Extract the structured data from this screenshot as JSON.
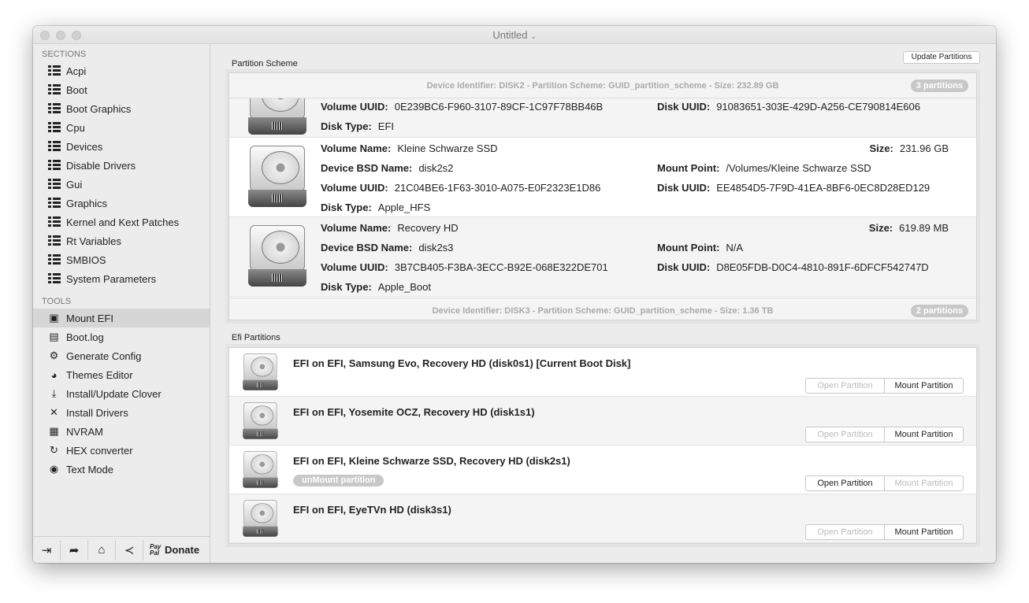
{
  "window": {
    "title": "Untitled"
  },
  "sidebar": {
    "sections_label": "SECTIONS",
    "sections": [
      "Acpi",
      "Boot",
      "Boot Graphics",
      "Cpu",
      "Devices",
      "Disable Drivers",
      "Gui",
      "Graphics",
      "Kernel and Kext Patches",
      "Rt Variables",
      "SMBIOS",
      "System Parameters"
    ],
    "tools_label": "TOOLS",
    "tools": [
      {
        "label": "Mount EFI",
        "icon": "disk-icon",
        "selected": true
      },
      {
        "label": "Boot.log",
        "icon": "log-icon"
      },
      {
        "label": "Generate Config",
        "icon": "gear-icon"
      },
      {
        "label": "Themes Editor",
        "icon": "palette-icon"
      },
      {
        "label": "Install/Update Clover",
        "icon": "download-icon"
      },
      {
        "label": "Install Drivers",
        "icon": "tools-icon"
      },
      {
        "label": "NVRAM",
        "icon": "chip-icon"
      },
      {
        "label": "HEX converter",
        "icon": "refresh-icon"
      },
      {
        "label": "Text Mode",
        "icon": "eye-icon"
      }
    ],
    "bottom": {
      "paypal": "Pay Pal",
      "donate": "Donate"
    }
  },
  "partition_scheme": {
    "label": "Partition Scheme",
    "update_button": "Update Partitions",
    "disk2_header": "Device Identifier: DISK2 - Partition Scheme: GUID_partition_scheme - Size: 232.89 GB",
    "disk2_badge": "3 partitions",
    "disk3_header": "Device Identifier: DISK3 - Partition Scheme: GUID_partition_scheme - Size: 1.36 TB",
    "disk3_badge": "2 partitions",
    "labels": {
      "volume_name": "Volume Name:",
      "bsd": "Device BSD Name:",
      "volume_uuid": "Volume UUID:",
      "disk_type": "Disk Type:",
      "size": "Size:",
      "mount_point": "Mount Point:",
      "disk_uuid": "Disk UUID:"
    },
    "partitions": [
      {
        "volume_uuid": "0E239BC6-F960-3107-89CF-1C97F78BB46B",
        "disk_uuid": "91083651-303E-429D-A256-CE790814E606",
        "disk_type": "EFI"
      },
      {
        "volume_name": "Kleine Schwarze SSD",
        "size": "231.96 GB",
        "bsd": "disk2s2",
        "mount_point": "/Volumes/Kleine Schwarze SSD",
        "volume_uuid": "21C04BE6-1F63-3010-A075-E0F2323E1D86",
        "disk_uuid": "EE4854D5-7F9D-41EA-8BF6-0EC8D28ED129",
        "disk_type": "Apple_HFS"
      },
      {
        "volume_name": "Recovery HD",
        "size": "619.89 MB",
        "bsd": "disk2s3",
        "mount_point": "N/A",
        "volume_uuid": "3B7CB405-F3BA-3ECC-B92E-068E322DE701",
        "disk_uuid": "D8E05FDB-D0C4-4810-891F-6DFCF542747D",
        "disk_type": "Apple_Boot"
      }
    ]
  },
  "efi": {
    "label": "Efi Partitions",
    "open": "Open Partition",
    "mount": "Mount Partition",
    "unmount": "unMount partition",
    "items": [
      {
        "title": "EFI on EFI, Samsung Evo, Recovery HD (disk0s1) [Current Boot Disk]",
        "mounted": false
      },
      {
        "title": "EFI on EFI, Yosemite OCZ, Recovery HD (disk1s1)",
        "mounted": false
      },
      {
        "title": "EFI on EFI, Kleine Schwarze SSD, Recovery HD (disk2s1)",
        "mounted": true
      },
      {
        "title": "EFI on EFI, EyeTVn HD (disk3s1)",
        "mounted": false
      }
    ]
  }
}
